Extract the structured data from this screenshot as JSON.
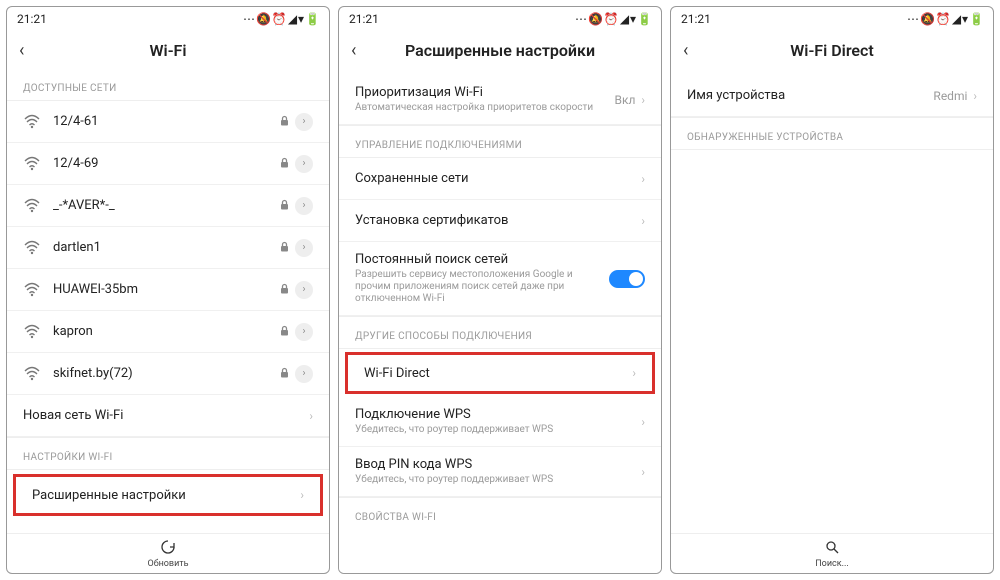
{
  "status": {
    "time": "21:21",
    "icons": "⋯ 🔕 ⏰ ◢ ▾ 🔋"
  },
  "screen1": {
    "title": "Wi-Fi",
    "section_available": "ДОСТУПНЫЕ СЕТИ",
    "networks": [
      {
        "ssid": "12/4-61",
        "locked": true
      },
      {
        "ssid": "12/4-69",
        "locked": true
      },
      {
        "ssid": "_-*AVER*-_",
        "locked": true
      },
      {
        "ssid": "dartlen1",
        "locked": true
      },
      {
        "ssid": "HUAWEI-35bm",
        "locked": true
      },
      {
        "ssid": "kapron",
        "locked": true
      },
      {
        "ssid": "skifnet.by(72)",
        "locked": true
      }
    ],
    "new_network": "Новая сеть Wi-Fi",
    "section_settings": "НАСТРОЙКИ WI-FI",
    "advanced": "Расширенные настройки",
    "refresh": "Обновить"
  },
  "screen2": {
    "title": "Расширенные настройки",
    "priority": {
      "title": "Приоритизация Wi-Fi",
      "sub": "Автоматическая настройка приоритетов скорости",
      "value": "Вкл"
    },
    "section_conn": "УПРАВЛЕНИЕ ПОДКЛЮЧЕНИЯМИ",
    "saved": "Сохраненные сети",
    "certs": "Установка сертификатов",
    "scan": {
      "title": "Постоянный поиск сетей",
      "sub": "Разрешить сервису местоположения Google и прочим приложениям поиск сетей даже при отключенном Wi-Fi"
    },
    "section_other": "ДРУГИЕ СПОСОБЫ ПОДКЛЮЧЕНИЯ",
    "wifi_direct": "Wi-Fi Direct",
    "wps": {
      "title": "Подключение WPS",
      "sub": "Убедитесь, что роутер поддерживает WPS"
    },
    "wps_pin": {
      "title": "Ввод PIN кода WPS",
      "sub": "Убедитесь, что роутер поддерживает WPS"
    },
    "section_props": "СВОЙСТВА WI-FI"
  },
  "screen3": {
    "title": "Wi-Fi Direct",
    "device_name": {
      "label": "Имя устройства",
      "value": "Redmi"
    },
    "section_found": "ОБНАРУЖЕННЫЕ УСТРОЙСТВА",
    "search": "Поиск..."
  }
}
